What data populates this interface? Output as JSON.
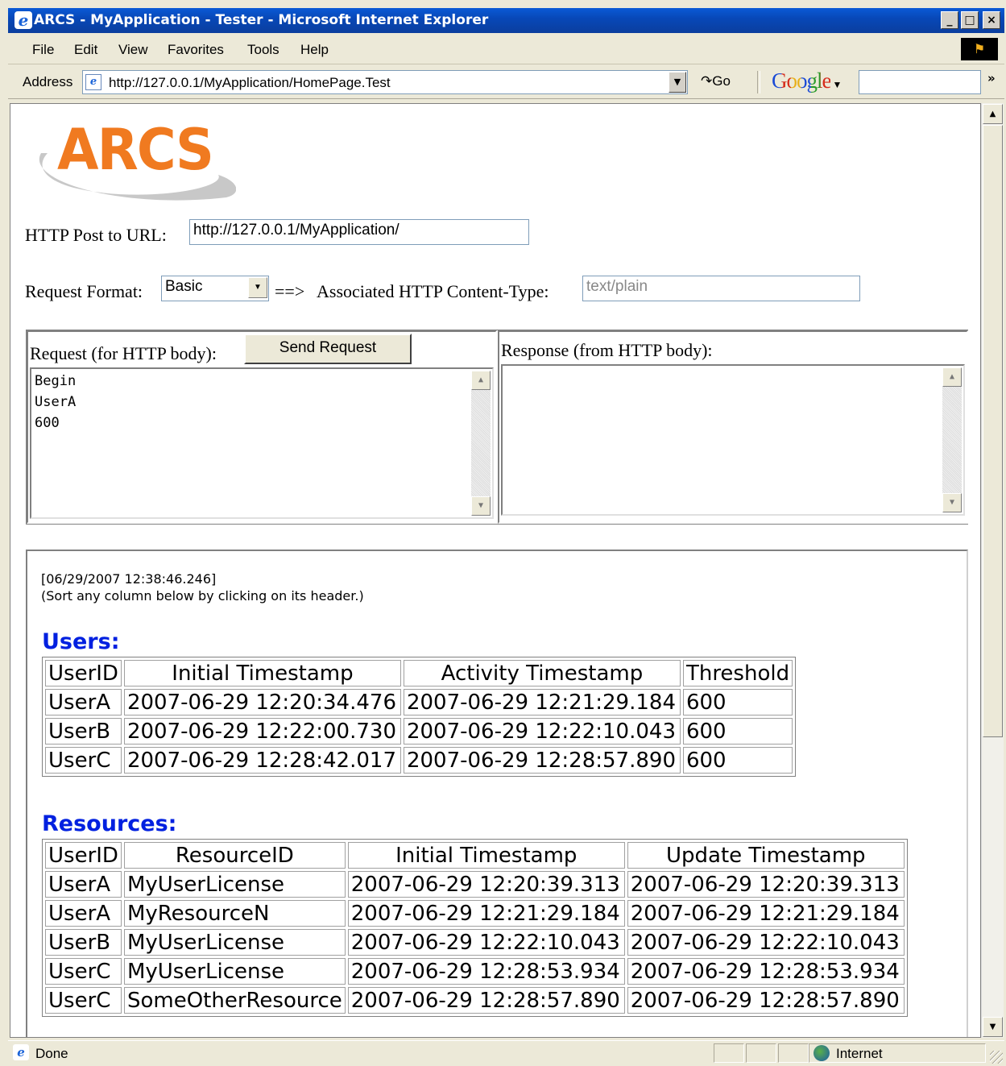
{
  "window": {
    "title": "ARCS - MyApplication - Tester - Microsoft Internet Explorer",
    "min_label": "_",
    "max_label": "□",
    "close_label": "×"
  },
  "menu": {
    "items": [
      {
        "label": "File"
      },
      {
        "label": "Edit"
      },
      {
        "label": "View"
      },
      {
        "label": "Favorites"
      },
      {
        "label": "Tools"
      },
      {
        "label": "Help"
      }
    ]
  },
  "address": {
    "label": "Address",
    "url": "http://127.0.0.1/MyApplication/HomePage.Test",
    "go_label": "Go",
    "google_label": "Google",
    "google_search_value": "",
    "more_label": "»"
  },
  "page": {
    "logo_text": "ARCS",
    "post_url_label": "HTTP Post to URL:",
    "post_url_value": "http://127.0.0.1/MyApplication/",
    "request_format_label": "Request Format:",
    "request_format_value": "Basic",
    "arrow_label": "==>",
    "content_type_label": "Associated HTTP Content-Type:",
    "content_type_value": "text/plain",
    "request_body_label": "Request (for HTTP body):",
    "send_button_label": "Send Request",
    "request_body_lines": [
      "Begin",
      "UserA",
      "600"
    ],
    "response_body_label": "Response (from HTTP body):",
    "response_body_value": "",
    "timestamp": "[06/29/2007 12:38:46.246]",
    "sort_hint": "(Sort any column below by clicking on its header.)"
  },
  "users": {
    "title": "Users:",
    "headers": [
      "UserID",
      "Initial Timestamp",
      "Activity Timestamp",
      "Threshold"
    ],
    "rows": [
      [
        "UserA",
        "2007-06-29 12:20:34.476",
        "2007-06-29 12:21:29.184",
        "600"
      ],
      [
        "UserB",
        "2007-06-29 12:22:00.730",
        "2007-06-29 12:22:10.043",
        "600"
      ],
      [
        "UserC",
        "2007-06-29 12:28:42.017",
        "2007-06-29 12:28:57.890",
        "600"
      ]
    ]
  },
  "resources": {
    "title": "Resources:",
    "headers": [
      "UserID",
      "ResourceID",
      "Initial Timestamp",
      "Update Timestamp"
    ],
    "rows": [
      [
        "UserA",
        "MyUserLicense",
        "2007-06-29 12:20:39.313",
        "2007-06-29 12:20:39.313"
      ],
      [
        "UserA",
        "MyResourceN",
        "2007-06-29 12:21:29.184",
        "2007-06-29 12:21:29.184"
      ],
      [
        "UserB",
        "MyUserLicense",
        "2007-06-29 12:22:10.043",
        "2007-06-29 12:22:10.043"
      ],
      [
        "UserC",
        "MyUserLicense",
        "2007-06-29 12:28:53.934",
        "2007-06-29 12:28:53.934"
      ],
      [
        "UserC",
        "SomeOtherResource",
        "2007-06-29 12:28:57.890",
        "2007-06-29 12:28:57.890"
      ]
    ]
  },
  "status": {
    "text": "Done",
    "zone": "Internet"
  },
  "colors": {
    "logo": "#f07a20",
    "section_heading": "#0020e0",
    "titlebar": "#0848b8"
  }
}
